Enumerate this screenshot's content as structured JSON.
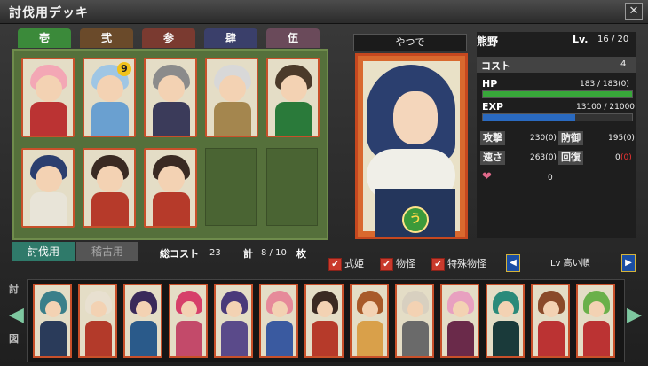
{
  "window": {
    "title": "討伐用デッキ",
    "close": "✕"
  },
  "tabs": [
    {
      "label": "壱",
      "color": "#3b8a3a"
    },
    {
      "label": "弐",
      "color": "#6a4a2a"
    },
    {
      "label": "参",
      "color": "#7a3a30"
    },
    {
      "label": "肆",
      "color": "#3a3f6a"
    },
    {
      "label": "伍",
      "color": "#6a4a5a"
    }
  ],
  "deck_cards": [
    {
      "hair": "#f3a7b5",
      "body": "#b33"
    },
    {
      "hair": "#9fc6e4",
      "body": "#6aa0d0",
      "badge": "9"
    },
    {
      "hair": "#8b8b8b",
      "body": "#3b3b5a"
    },
    {
      "hair": "#d8d8d8",
      "body": "#a4864e"
    },
    {
      "hair": "#4b3a2a",
      "body": "#2a7a3a"
    },
    {
      "hair": "#2b3f6f",
      "body": "#e8e4d8"
    },
    {
      "hair": "#3a2a22",
      "body": "#b63a2a"
    },
    {
      "hair": "#3a2a22",
      "body": "#b63a2a"
    }
  ],
  "selected": {
    "owner": "やつで",
    "name": "熊野",
    "lv_label": "Lv.",
    "lv": "16 / 20",
    "badge": "う"
  },
  "stats": {
    "cost_label": "コスト",
    "cost": "4",
    "hp_label": "HP",
    "hp": "183 / 183(0)",
    "hp_fraction": 1.0,
    "exp_label": "EXP",
    "exp": "13100 / 21000",
    "exp_fraction": 0.62,
    "atk_label": "攻撃",
    "atk": "230(0)",
    "def_label": "防御",
    "def": "195(0)",
    "spd_label": "速さ",
    "spd": "263(0)",
    "rec_label": "回復",
    "rec": "0",
    "rec_bonus": "(0)",
    "heart": "❤",
    "love": "0"
  },
  "bottom": {
    "tab_active": "討伐用",
    "tab_inactive": "稽古用",
    "total_cost_label": "総コスト",
    "total_cost": "23",
    "count_label": "計",
    "count": "8 / 10",
    "count_unit": "枚"
  },
  "filters": [
    {
      "label": "式姫",
      "checked": true
    },
    {
      "label": "物怪",
      "checked": true
    },
    {
      "label": "特殊物怪",
      "checked": true
    }
  ],
  "sort": {
    "label": "Lv 高い順",
    "prev": "◀",
    "next": "▶"
  },
  "side": {
    "left_top": "討",
    "left_bottom": "図",
    "prev": "◀",
    "next": "▶"
  },
  "strip_cards": [
    {
      "hair": "#3a7f8a",
      "body": "#2a3b5a"
    },
    {
      "hair": "#e8e0d0",
      "body": "#b33a2a"
    },
    {
      "hair": "#3a2a5a",
      "body": "#2a5a8a"
    },
    {
      "hair": "#d6406a",
      "body": "#c34a6a"
    },
    {
      "hair": "#4a3a7a",
      "body": "#5a4a8a"
    },
    {
      "hair": "#e68a9a",
      "body": "#3a5aa0"
    },
    {
      "hair": "#3a2a22",
      "body": "#b63a2a"
    },
    {
      "hair": "#a85a2a",
      "body": "#d9a04a"
    },
    {
      "hair": "#d8d0c0",
      "body": "#6a6a6a"
    },
    {
      "hair": "#e8a0c0",
      "body": "#6a2a4a"
    },
    {
      "hair": "#2a8a7a",
      "body": "#1a3a3a"
    },
    {
      "hair": "#8a4a2a",
      "body": "#b33"
    },
    {
      "hair": "#6ab04a",
      "body": "#b33"
    }
  ]
}
